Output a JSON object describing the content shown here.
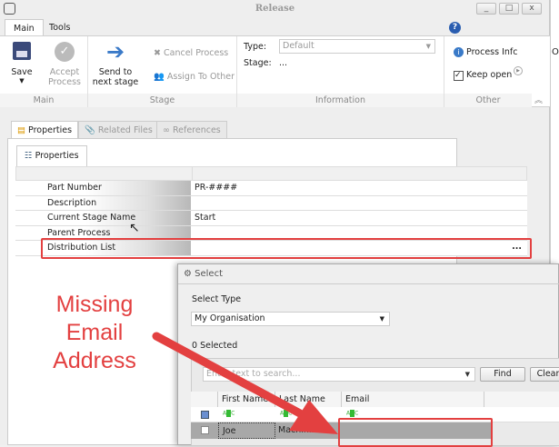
{
  "window": {
    "title": "Release",
    "min": "_",
    "max": "□",
    "close": "x"
  },
  "tabs": [
    "Main",
    "Tools"
  ],
  "ribbon": {
    "save": "Save",
    "accept": [
      "Accept",
      "Process"
    ],
    "send": [
      "Send to",
      "next stage"
    ],
    "cancel": "Cancel Process",
    "assign": "Assign To Other",
    "type_label": "Type:",
    "type_value": "Default",
    "stage_label": "Stage:",
    "stage_value": "...",
    "process_info": "Process Infc",
    "keep_open": "Keep open",
    "groups": [
      "Main",
      "Stage",
      "Information",
      "Other"
    ]
  },
  "side_strip": {
    "letter": "O"
  },
  "prop_tabs": [
    "Properties",
    "Related Files",
    "References"
  ],
  "inner_tab": "Properties",
  "properties": [
    {
      "label": "Part Number",
      "value": "PR-####",
      "required": true
    },
    {
      "label": "Description",
      "value": "",
      "required": true
    },
    {
      "label": "Current Stage Name",
      "value": "Start",
      "required": false
    },
    {
      "label": "Parent Process",
      "value": "",
      "required": false
    },
    {
      "label": "Distribution List",
      "value": "",
      "required": false,
      "button": "..."
    }
  ],
  "annotation": {
    "lines": [
      "Missing",
      "Email",
      "Address"
    ],
    "color": "#e34040"
  },
  "dialog": {
    "title": "Select",
    "select_type_label": "Select Type",
    "select_type_value": "My Organisation",
    "selected_count": "0 Selected",
    "search_placeholder": "Enter text to search...",
    "find": "Find",
    "clear": "Clear",
    "columns": [
      "First Name",
      "Last Name",
      "Email"
    ],
    "rows": [
      {
        "first": "Joe",
        "last": "Machinist",
        "email": ""
      }
    ]
  }
}
